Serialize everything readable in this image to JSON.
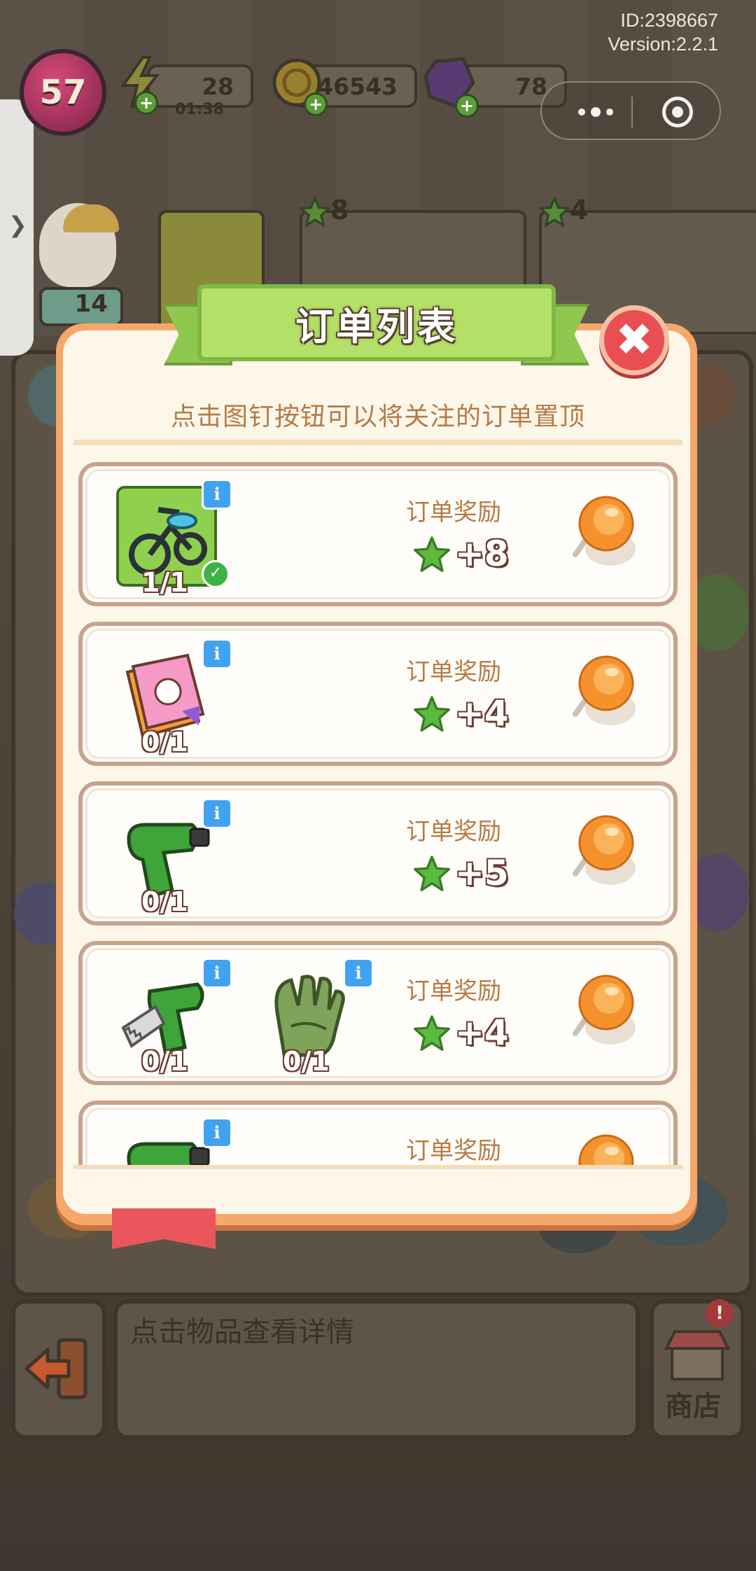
{
  "hud": {
    "id_text": "ID:2398667",
    "version_text": "Version:2.2.1",
    "level": "57",
    "energy": "28",
    "energy_timer": "01:38",
    "coins": "46543",
    "gems": "78"
  },
  "background_orders": [
    {
      "reward": "8"
    },
    {
      "reward": "4"
    }
  ],
  "background_misc": {
    "star_count": "14"
  },
  "modal": {
    "title": "订单列表",
    "hint": "点击图钉按钮可以将关注的订单置顶",
    "orders": [
      {
        "items": [
          {
            "name": "bike",
            "count": "1/1",
            "done": true
          }
        ],
        "reward_label": "订单奖励",
        "reward": "+8"
      },
      {
        "items": [
          {
            "name": "spellbook",
            "count": "0/1"
          }
        ],
        "reward_label": "订单奖励",
        "reward": "+4"
      },
      {
        "items": [
          {
            "name": "drill",
            "count": "0/1"
          }
        ],
        "reward_label": "订单奖励",
        "reward": "+5"
      },
      {
        "items": [
          {
            "name": "saw-drill",
            "count": "0/1"
          },
          {
            "name": "gloves",
            "count": "0/1"
          }
        ],
        "reward_label": "订单奖励",
        "reward": "+4"
      },
      {
        "items": [
          {
            "name": "drill"
          }
        ],
        "reward_label": "订单奖励"
      }
    ]
  },
  "bottom": {
    "detail_placeholder": "点击物品查看详情",
    "shop_label": "商店"
  },
  "colors": {
    "banner_green": "#b5e067",
    "close_red": "#e94e52",
    "reward_text": "#b57b46",
    "modal_border": "#f6a86a",
    "star_green": "#5dbb3c",
    "pin_orange": "#f5922d"
  }
}
